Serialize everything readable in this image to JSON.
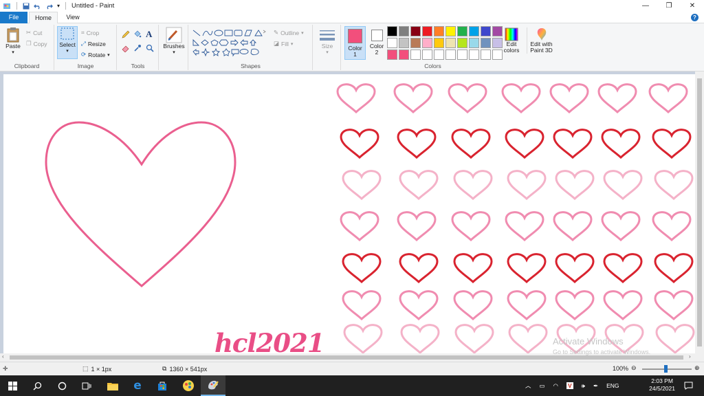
{
  "window": {
    "title": "Untitled - Paint",
    "minimize": "—",
    "maximize": "❐",
    "close": "✕"
  },
  "menu": {
    "file": "File",
    "home": "Home",
    "view": "View"
  },
  "ribbon": {
    "clipboard": {
      "group": "Clipboard",
      "paste": "Paste",
      "cut": "Cut",
      "copy": "Copy"
    },
    "image": {
      "group": "Image",
      "select": "Select",
      "crop": "Crop",
      "resize": "Resize",
      "rotate": "Rotate"
    },
    "tools": {
      "group": "Tools"
    },
    "brushes": {
      "label": "Brushes"
    },
    "shapes": {
      "group": "Shapes",
      "outline": "Outline",
      "fill": "Fill"
    },
    "size": {
      "label": "Size"
    },
    "colors": {
      "group": "Colors",
      "color1": "Color\n1",
      "color1_line1": "Color",
      "color1_line2": "1",
      "color2_line1": "Color",
      "color2_line2": "2",
      "edit_line1": "Edit",
      "edit_line2": "colors",
      "color1_value": "#f24f7c",
      "color2_value": "#ffffff",
      "palette_row1": [
        "#000000",
        "#7f7f7f",
        "#880015",
        "#ed1c24",
        "#ff7f27",
        "#fff200",
        "#22b14c",
        "#00a2e8",
        "#3f48cc",
        "#a349a4"
      ],
      "palette_row2": [
        "#ffffff",
        "#c3c3c3",
        "#b97a57",
        "#ffaec9",
        "#ffc90e",
        "#efe4b0",
        "#b5e61d",
        "#99d9ea",
        "#7092be",
        "#c8bfe7"
      ],
      "palette_row3": [
        "#f24f7c",
        "#f24f7c",
        "#ffffff",
        "#ffffff",
        "#ffffff",
        "#ffffff",
        "#ffffff",
        "#ffffff",
        "#ffffff",
        "#ffffff"
      ]
    },
    "paint3d": {
      "line1": "Edit with",
      "line2": "Paint 3D"
    }
  },
  "canvas": {
    "signature": "hcl2021",
    "big_heart_color": "#ea5f8f",
    "heart_rows": [
      {
        "color": "#f08cb0"
      },
      {
        "color": "#d9232f"
      },
      {
        "color": "#f4b2c8"
      },
      {
        "color": "#f08cb0"
      },
      {
        "color": "#d9232f"
      },
      {
        "color": "#f08cb0"
      },
      {
        "color": "#f4b2c8"
      }
    ]
  },
  "watermark": {
    "line1": "Activate Windows",
    "line2": "Go to Settings to activate Windows."
  },
  "status": {
    "selection_size": "1 × 1px",
    "canvas_size": "1360 × 541px",
    "zoom": "100%"
  },
  "taskbar": {
    "language": "ENG",
    "time": "2:03 PM",
    "date": "24/5/2021"
  }
}
